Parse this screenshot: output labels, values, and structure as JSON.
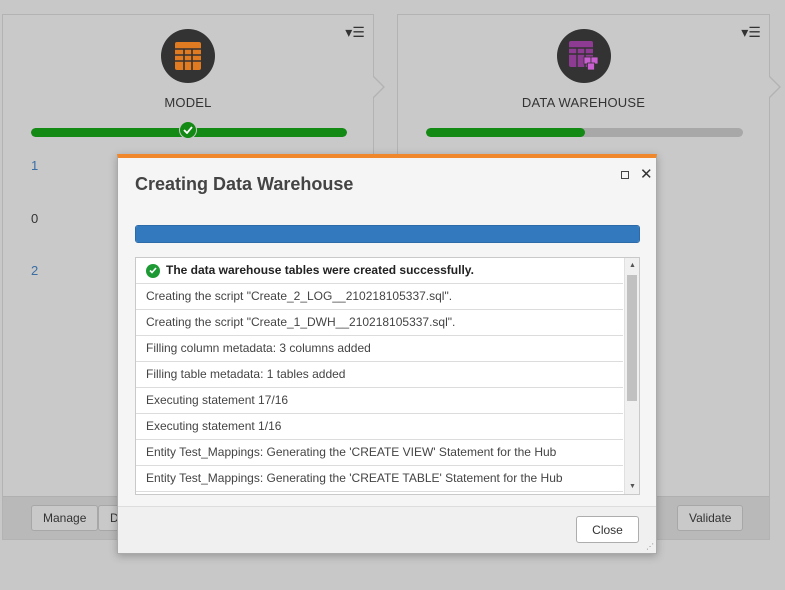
{
  "cards": {
    "model": {
      "title": "MODEL",
      "progress_fraction": 1.0,
      "stats": [
        "1",
        "0",
        "2"
      ],
      "buttons": {
        "manage": "Manage",
        "second_partial": "D"
      }
    },
    "data_warehouse": {
      "title": "DATA WAREHOUSE",
      "progress_fraction": 0.5,
      "buttons": {
        "validate": "Validate"
      }
    }
  },
  "dialog": {
    "title": "Creating Data Warehouse",
    "progress_fraction": 1.0,
    "log": [
      "The data warehouse tables were created successfully.",
      "Creating the script \"Create_2_LOG__210218105337.sql\".",
      "Creating the script \"Create_1_DWH__210218105337.sql\".",
      "Filling column metadata: 3 columns added",
      "Filling table metadata: 1 tables added",
      "Executing statement 17/16",
      "Executing statement 1/16",
      "Entity Test_Mappings: Generating the 'CREATE VIEW' Statement for the Hub",
      "Entity Test_Mappings: Generating the 'CREATE TABLE' Statement for the Hub"
    ],
    "close_label": "Close"
  },
  "colors": {
    "accent_orange": "#f0882b",
    "progress_blue": "#3279bd",
    "success_green": "#138a13",
    "model_icon": "#e07b22",
    "dwh_icon": "#b040b8"
  },
  "icons": {
    "model": "table-icon",
    "data_warehouse": "database-table-icon",
    "card_menu": "menu-dropdown-icon",
    "success": "check-circle-icon"
  }
}
